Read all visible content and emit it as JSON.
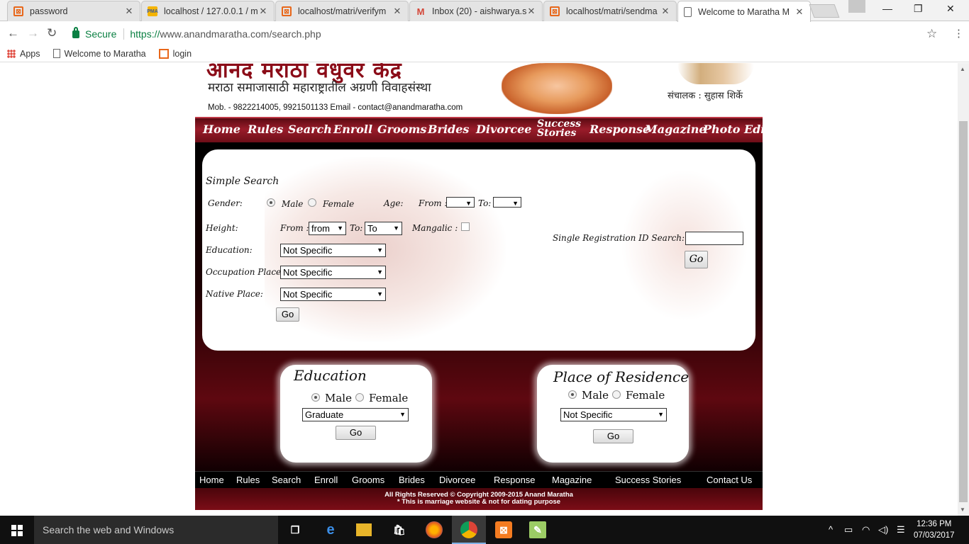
{
  "browser": {
    "tabs": [
      {
        "label": "password",
        "icon": "xampp-icon"
      },
      {
        "label": "localhost / 127.0.0.1 / m",
        "icon": "phpmyadmin-icon"
      },
      {
        "label": "localhost/matri/verifym",
        "icon": "xampp-icon"
      },
      {
        "label": "Inbox (20) - aishwarya.s",
        "icon": "gmail-icon"
      },
      {
        "label": "localhost/matri/sendma",
        "icon": "xampp-icon"
      },
      {
        "label": "Welcome to Maratha M",
        "icon": "page-icon"
      }
    ],
    "secure_label": "Secure",
    "url_scheme": "https://",
    "url_host": "www.anandmaratha.com",
    "url_path": "/search.php",
    "bookmarks": [
      "Apps",
      "Welcome to Maratha",
      "login"
    ]
  },
  "header": {
    "title": "आनंद मराठा वधुवर केंद्र",
    "subtitle": "मराठा समाजासाठी महाराष्ट्रातील अग्रणी विवाहसंस्था",
    "contact": "Mob. - 9822214005, 9921501133   Email - contact@anandmaratha.com",
    "director": "संचालक : सुहास शिर्के"
  },
  "nav": [
    "Home",
    "Rules",
    "Search",
    "Enroll",
    "Grooms",
    "Brides",
    "Divorcee",
    "Success Stories",
    "Response",
    "Magazine",
    "Photo Edit"
  ],
  "simple_search": {
    "title": "Simple Search",
    "gender_label": "Gender:",
    "male": "Male",
    "female": "Female",
    "age_label": "Age:",
    "from_label": "From :",
    "to_label": "To:",
    "height_label": "Height:",
    "height_from": "from",
    "height_to": "To",
    "mangalic_label": "Mangalic :",
    "education_label": "Education:",
    "occupation_label": "Occupation Place:",
    "native_label": "Native Place:",
    "not_specific": "Not Specific",
    "go": "Go",
    "reg_label": "Single Registration ID Search:",
    "reg_go": "Go"
  },
  "education_box": {
    "title": "Education",
    "male": "Male",
    "female": "Female",
    "selected": "Graduate",
    "go": "Go"
  },
  "residence_box": {
    "title": "Place of Residence",
    "male": "Male",
    "female": "Female",
    "selected": "Not Specific",
    "go": "Go"
  },
  "footer_nav": [
    "Home",
    "Rules",
    "Search",
    "Enroll",
    "Grooms",
    "Brides",
    "Divorcee",
    "Response",
    "Magazine",
    "Success Stories",
    "Contact Us"
  ],
  "copyright": "All Rights Reserved © Copyright 2009-2015 Anand Maratha",
  "disclaimer": "* This is marriage website & not for dating purpose",
  "taskbar": {
    "search_placeholder": "Search the web and Windows",
    "time": "12:36 PM",
    "date": "07/03/2017"
  }
}
